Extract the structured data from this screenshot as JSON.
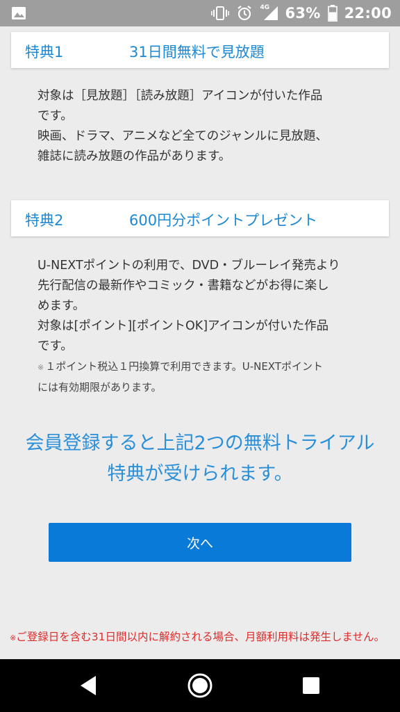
{
  "status_bar": {
    "network": "4G",
    "battery_percent": "63%",
    "battery_level": 0.63,
    "time": "22:00",
    "icons": [
      "image-notification-icon",
      "vibrate-icon",
      "alarm-icon",
      "signal-icon",
      "battery-icon"
    ]
  },
  "benefits": [
    {
      "label": "特典1",
      "title": "31日間無料で見放題",
      "lines": [
        "対象は［見放題］［読み放題］アイコンが付いた作品",
        "です。",
        "映画、ドラマ、アニメなど全てのジャンルに見放題、",
        "雑誌に読み放題の作品があります。"
      ]
    },
    {
      "label": "特典2",
      "title": "600円分ポイントプレゼント",
      "lines": [
        "U-NEXTポイントの利用で、DVD・ブルーレイ発売より",
        "先行配信の最新作やコミック・書籍などがお得に楽し",
        "めます。",
        "対象は[ポイント][ポイントOK]アイコンが付いた作品",
        "です。"
      ],
      "note_mark": "※",
      "note_lines": [
        "１ポイント税込１円換算で利用できます。U-NEXTポイント",
        "には有効期限があります。"
      ]
    }
  ],
  "cta": {
    "message_lines": [
      "会員登録すると上記2つの無料トライアル",
      "特典が受けられます。"
    ],
    "next_label": "次へ"
  },
  "footer": {
    "mark": "※",
    "note": "ご登録日を含む31日間以内に解約される場合、月額利用料は発生しません。"
  },
  "colors": {
    "accent": "#1e88d2",
    "button": "#0a7ad8",
    "warning": "#e02a2a",
    "status_bar": "#9e9e9e"
  },
  "nav_bar": {
    "icons": [
      "back-icon",
      "home-icon",
      "recents-icon"
    ]
  }
}
